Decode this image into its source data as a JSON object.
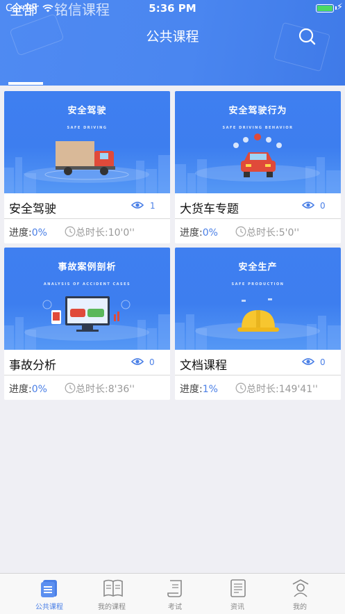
{
  "status_bar": {
    "carrier": "Carrier",
    "time": "5:36 PM",
    "charging_icon": "bolt-icon"
  },
  "header": {
    "title": "公共课程",
    "search_icon": "search-icon"
  },
  "tabs": [
    {
      "label": "全部",
      "active": true
    },
    {
      "label": "铭信课程",
      "active": false
    }
  ],
  "courses": [
    {
      "name": "安全驾驶",
      "views": "1",
      "progress_label": "进度:",
      "progress": "0%",
      "duration_label": "总时长:",
      "duration": "10'0''",
      "banner_title": "安全驾驶",
      "banner_sub": "SAFE DRIVING",
      "illustration": "truck-icon"
    },
    {
      "name": "大货车专题",
      "views": "0",
      "progress_label": "进度:",
      "progress": "0%",
      "duration_label": "总时长:",
      "duration": "5'0''",
      "banner_title": "安全驾驶行为",
      "banner_sub": "SAFE DRIVING BEHAVIOR",
      "illustration": "car-icon"
    },
    {
      "name": "事故分析",
      "views": "0",
      "progress_label": "进度:",
      "progress": "0%",
      "duration_label": "总时长:",
      "duration": "8'36''",
      "banner_title": "事故案例剖析",
      "banner_sub": "ANALYSIS OF ACCIDENT CASES",
      "illustration": "monitor-icon"
    },
    {
      "name": "文档课程",
      "views": "0",
      "progress_label": "进度:",
      "progress": "1%",
      "duration_label": "总时长:",
      "duration": "149'41''",
      "banner_title": "安全生产",
      "banner_sub": "SAFE PRODUCTION",
      "illustration": "hardhat-icon"
    }
  ],
  "tabbar": [
    {
      "label": "公共课程",
      "icon": "doc-list-icon",
      "active": true
    },
    {
      "label": "我的课程",
      "icon": "book-icon",
      "active": false
    },
    {
      "label": "考试",
      "icon": "scroll-icon",
      "active": false
    },
    {
      "label": "资讯",
      "icon": "news-icon",
      "active": false
    },
    {
      "label": "我的",
      "icon": "profile-icon",
      "active": false
    }
  ],
  "colors": {
    "primary": "#4a7fe6",
    "header": "#4a86f0",
    "background": "#efeff4"
  }
}
